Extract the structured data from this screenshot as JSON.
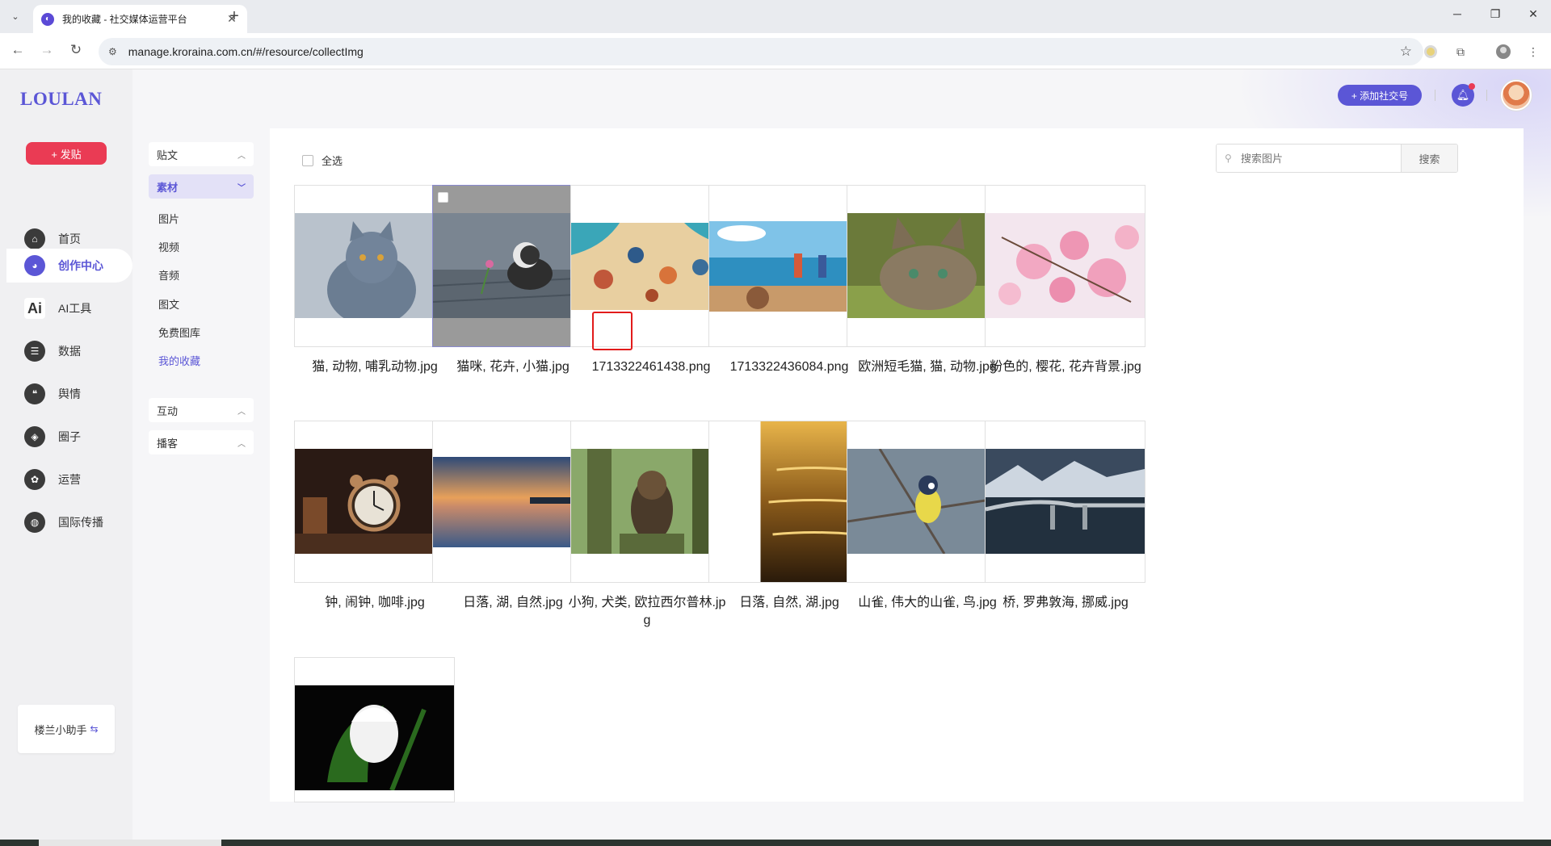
{
  "browser": {
    "tab_title": "我的收藏 - 社交媒体运营平台",
    "new_tab": "+",
    "url": "manage.kroraina.com.cn/#/resource/collectImg",
    "win_minimize": "─",
    "win_restore": "❐",
    "win_close": "✕"
  },
  "app": {
    "logo": "LOULAN",
    "post_button": "+ 发贴",
    "nav": [
      {
        "label": "首页",
        "icon": "home-icon"
      },
      {
        "label": "创作中心",
        "icon": "palette-icon"
      },
      {
        "label": "AI工具",
        "icon": "ai-icon"
      },
      {
        "label": "数据",
        "icon": "database-icon"
      },
      {
        "label": "舆情",
        "icon": "quote-icon"
      },
      {
        "label": "圈子",
        "icon": "compass-icon"
      },
      {
        "label": "运营",
        "icon": "settings-icon"
      },
      {
        "label": "国际传播",
        "icon": "globe-icon"
      }
    ],
    "helper": "楼兰小助手",
    "add_social": "+ 添加社交号"
  },
  "submenu": {
    "group1": "贴文",
    "group2": "素材",
    "items": [
      "图片",
      "视频",
      "音频",
      "图文",
      "免费图库",
      "我的收藏"
    ],
    "group3": "互动",
    "group4": "播客"
  },
  "content": {
    "select_all": "全选",
    "search_placeholder": "搜索图片",
    "search_button": "搜索",
    "images": [
      {
        "name": "猫, 动物, 哺乳动物.jpg"
      },
      {
        "name": "猫咪, 花卉, 小猫.jpg"
      },
      {
        "name": "1713322461438.png"
      },
      {
        "name": "1713322436084.png"
      },
      {
        "name": "欧洲短毛猫, 猫, 动物.jpg"
      },
      {
        "name": "粉色的, 樱花, 花卉背景.jpg"
      },
      {
        "name": "钟, 闹钟, 咖啡.jpg"
      },
      {
        "name": "日落, 湖, 自然.jpg"
      },
      {
        "name": "小狗, 犬类, 欧拉西尔普林.jpg"
      },
      {
        "name": "日落, 自然, 湖.jpg"
      },
      {
        "name": "山雀, 伟大的山雀, 鸟.jpg"
      },
      {
        "name": "桥, 罗弗敦海, 挪威.jpg"
      },
      {
        "name": ""
      }
    ]
  },
  "colors": {
    "accent": "#5b56d6",
    "danger": "#ea3b54",
    "star": "#f5b800"
  }
}
